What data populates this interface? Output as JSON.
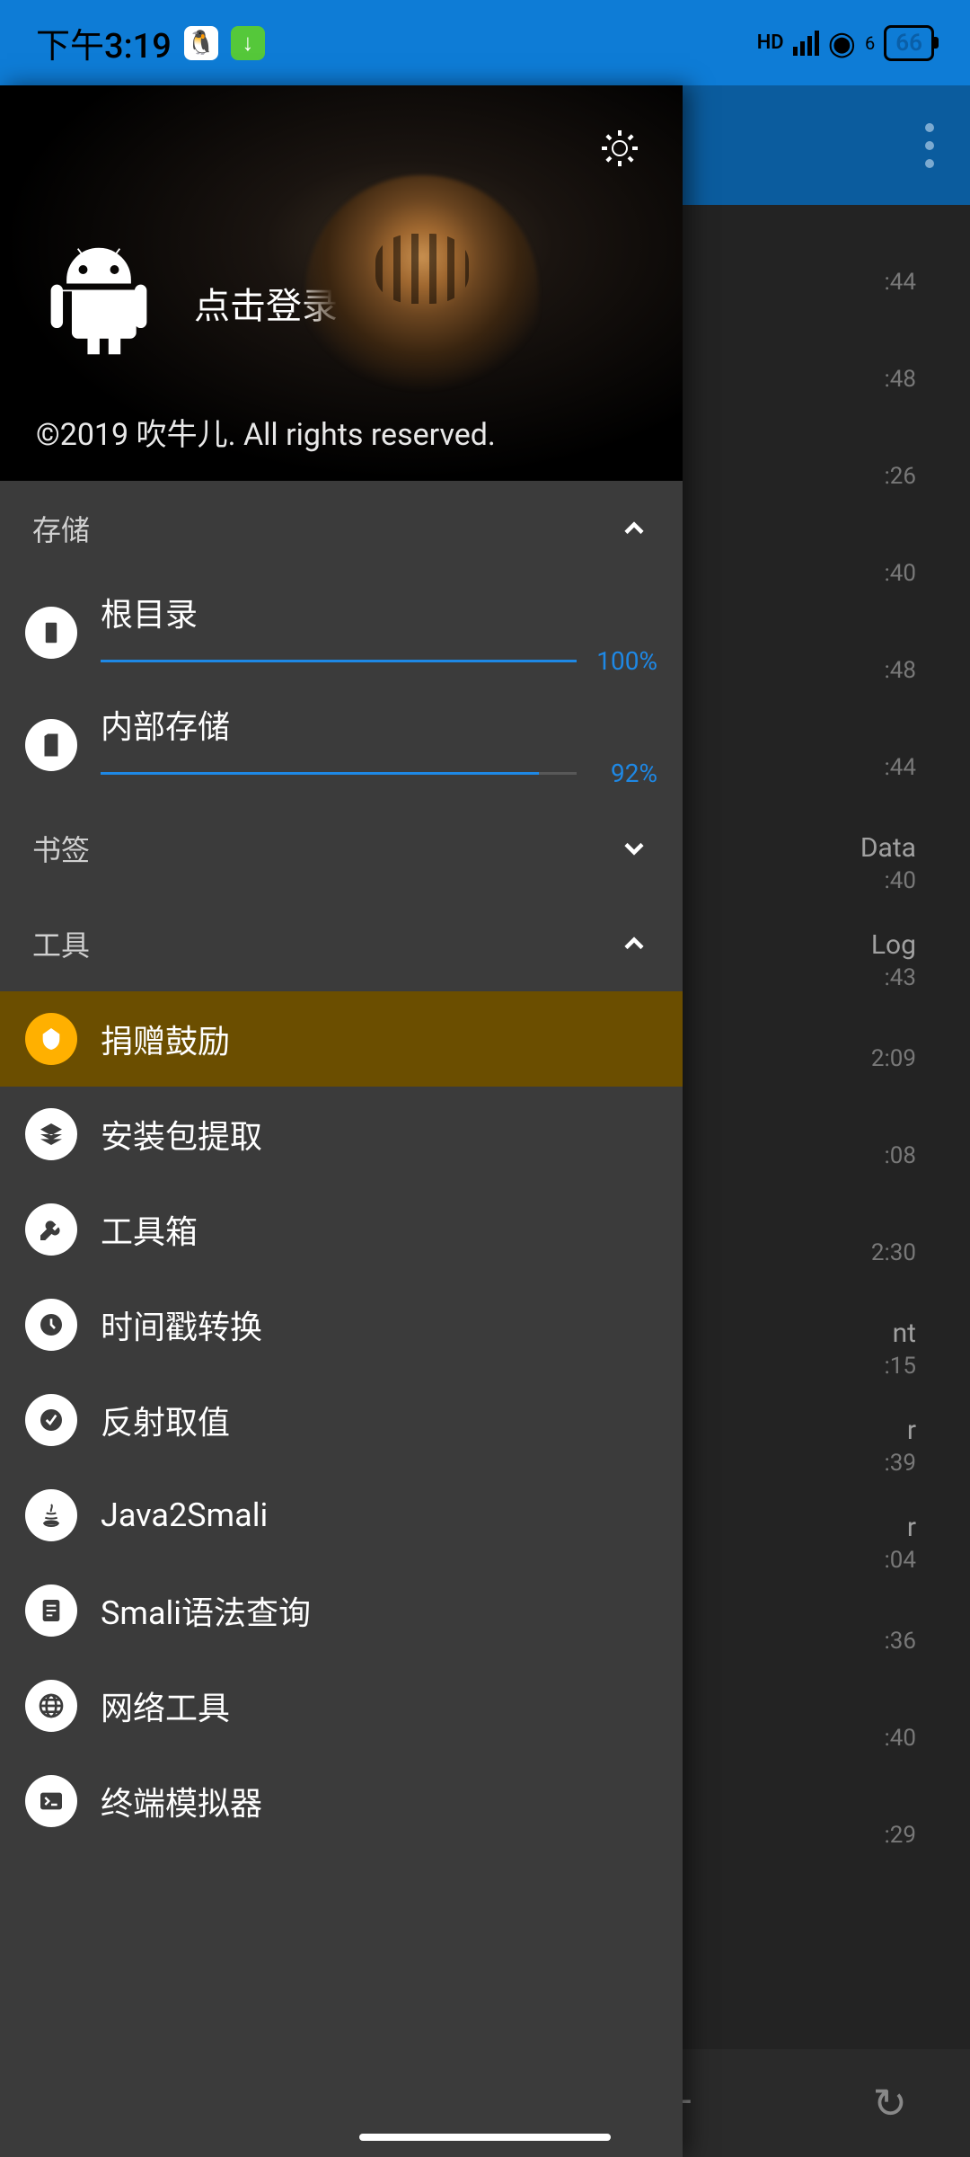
{
  "status": {
    "time": "下午3:19",
    "hd": "HD",
    "wifi_sub": "6",
    "battery": "66"
  },
  "bg": {
    "rows": [
      {
        "t1": "",
        "t2": ":44"
      },
      {
        "t1": "",
        "t2": ":48"
      },
      {
        "t1": "",
        "t2": ":26"
      },
      {
        "t1": "",
        "t2": ":40"
      },
      {
        "t1": "",
        "t2": ":48"
      },
      {
        "t1": "",
        "t2": ":44"
      },
      {
        "t1": "Data",
        "t2": ":40"
      },
      {
        "t1": "Log",
        "t2": ":43"
      },
      {
        "t1": "",
        "t2": "2:09"
      },
      {
        "t1": "",
        "t2": ":08"
      },
      {
        "t1": "",
        "t2": "2:30"
      },
      {
        "t1": "nt",
        "t2": ":15"
      },
      {
        "t1": "r",
        "t2": ":39"
      },
      {
        "t1": "r",
        "t2": ":04"
      },
      {
        "t1": "",
        "t2": ":36"
      },
      {
        "t1": "",
        "t2": ":40"
      },
      {
        "t1": "",
        "t2": ":29"
      }
    ]
  },
  "drawer": {
    "login": "点击登录",
    "copyright": "©2019 吹牛儿. All rights reserved.",
    "sections": {
      "storage": {
        "title": "存储",
        "expanded": true,
        "items": [
          {
            "label": "根目录",
            "pct": 100,
            "pct_label": "100%"
          },
          {
            "label": "内部存储",
            "pct": 92,
            "pct_label": "92%"
          }
        ]
      },
      "bookmarks": {
        "title": "书签",
        "expanded": false
      },
      "tools": {
        "title": "工具",
        "expanded": true,
        "items": [
          {
            "label": "捐赠鼓励",
            "icon": "donate",
            "highlight": true
          },
          {
            "label": "安装包提取",
            "icon": "layers"
          },
          {
            "label": "工具箱",
            "icon": "wrench"
          },
          {
            "label": "时间戳转换",
            "icon": "clock"
          },
          {
            "label": "反射取值",
            "icon": "reflect"
          },
          {
            "label": "Java2Smali",
            "icon": "java"
          },
          {
            "label": "Smali语法查询",
            "icon": "doc"
          },
          {
            "label": "网络工具",
            "icon": "globe"
          },
          {
            "label": "终端模拟器",
            "icon": "terminal"
          }
        ]
      }
    }
  }
}
